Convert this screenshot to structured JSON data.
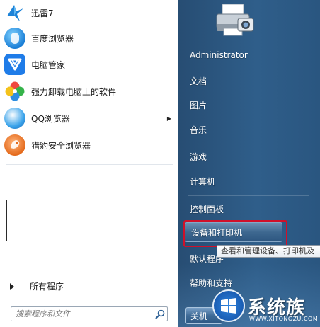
{
  "pinned_programs": [
    {
      "label": "迅雷7",
      "icon": "xunlei-bird-icon"
    },
    {
      "label": "百度浏览器",
      "icon": "baidu-browser-icon"
    },
    {
      "label": "电脑管家",
      "icon": "tencent-guanjia-icon"
    },
    {
      "label": "强力卸载电脑上的软件",
      "icon": "uninstall-pinwheel-icon"
    },
    {
      "label": "QQ浏览器",
      "icon": "qq-browser-icon",
      "has_submenu": true
    },
    {
      "label": "猎豹安全浏览器",
      "icon": "liebao-browser-icon"
    }
  ],
  "all_programs_label": "所有程序",
  "search": {
    "placeholder": "搜索程序和文件"
  },
  "right_menu": {
    "user": "Administrator",
    "items": [
      "文档",
      "图片",
      "音乐",
      "游戏",
      "计算机",
      "控制面板",
      "设备和打印机",
      "默认程序",
      "帮助和支持"
    ],
    "selected": "设备和打印机",
    "tooltip": "查看和管理设备、打印机及",
    "shutdown_label": "关机"
  },
  "watermark": {
    "text": "系统族",
    "domain": "WWW.XITONGZU.COM"
  },
  "colors": {
    "highlight_border": "#d0102a",
    "pane_blue": "#2f5e8a"
  }
}
